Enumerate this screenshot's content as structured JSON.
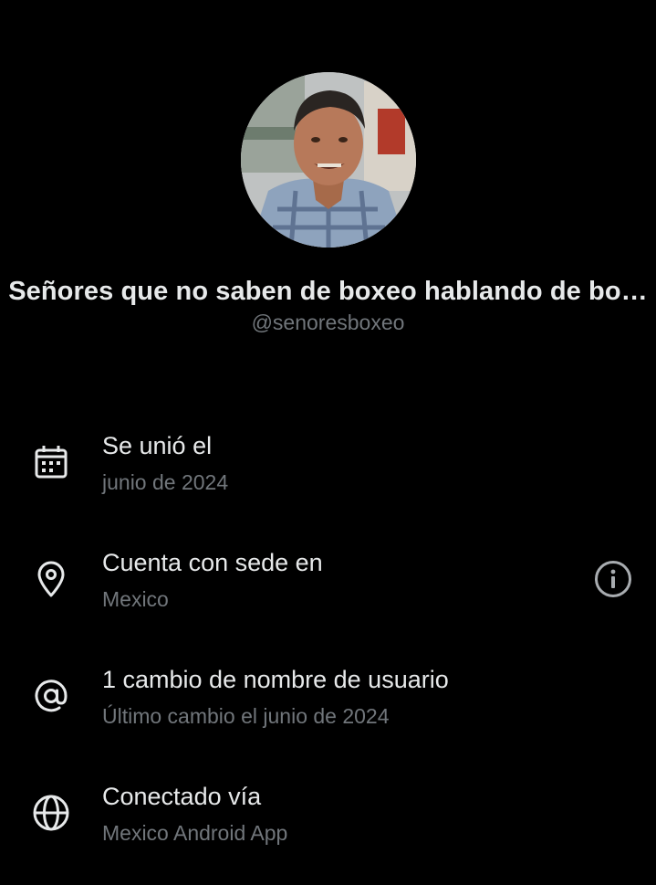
{
  "profile": {
    "display_name": "Señores que no saben de boxeo hablando de bo…",
    "handle": "@senoresboxeo"
  },
  "about": {
    "joined": {
      "icon": "calendar-icon",
      "title": "Se unió el",
      "value": "junio de 2024"
    },
    "location": {
      "icon": "location-pin-icon",
      "title": "Cuenta con sede en",
      "value": "Mexico",
      "action_icon": "info-icon"
    },
    "username_changes": {
      "icon": "at-sign-icon",
      "title": "1 cambio de nombre de usuario",
      "value": "Último cambio el junio de 2024"
    },
    "connected_via": {
      "icon": "globe-icon",
      "title": "Conectado vía",
      "value": "Mexico Android App"
    }
  },
  "colors": {
    "background": "#000000",
    "primary_text": "#e7e9ea",
    "secondary_text": "#71767b"
  }
}
